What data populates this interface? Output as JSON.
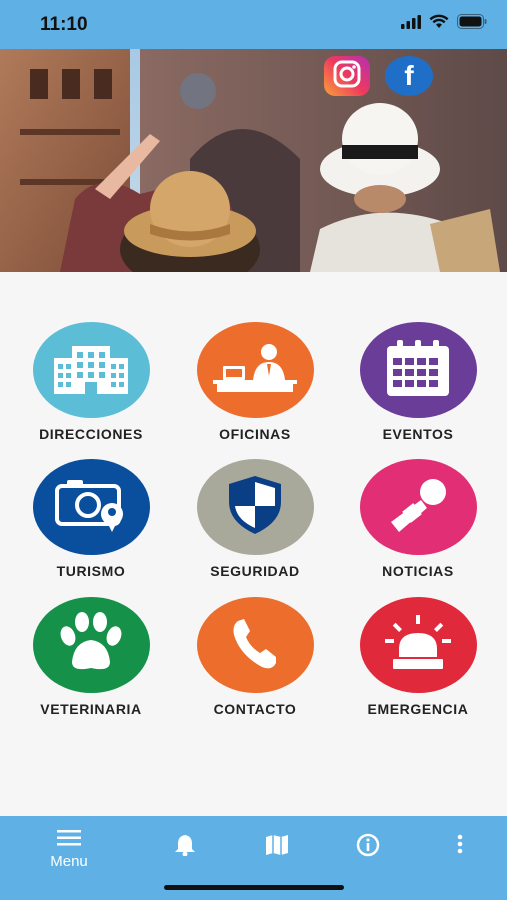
{
  "status_bar": {
    "time": "11:10"
  },
  "hero": {
    "social": [
      {
        "name": "instagram",
        "icon": "instagram-icon"
      },
      {
        "name": "facebook",
        "icon": "facebook-icon",
        "glyph": "f"
      }
    ]
  },
  "menu_grid": [
    {
      "label": "DIRECCIONES",
      "icon": "building-icon",
      "color": "#5bbdd6"
    },
    {
      "label": "OFICINAS",
      "icon": "office-desk-icon",
      "color": "#ec6d2c"
    },
    {
      "label": "EVENTOS",
      "icon": "calendar-icon",
      "color": "#6a3d98"
    },
    {
      "label": "TURISMO",
      "icon": "camera-icon",
      "color": "#0a4f9e"
    },
    {
      "label": "SEGURIDAD",
      "icon": "shield-icon",
      "color": "#a8a99b"
    },
    {
      "label": "NOTICIAS",
      "icon": "microphone-icon",
      "color": "#e12e74"
    },
    {
      "label": "VETERINARIA",
      "icon": "paw-icon",
      "color": "#16914a"
    },
    {
      "label": "CONTACTO",
      "icon": "phone-icon",
      "color": "#ec6d2c"
    },
    {
      "label": "EMERGENCIA",
      "icon": "siren-icon",
      "color": "#e0293b"
    }
  ],
  "bottom_nav": {
    "menu_label": "Menu",
    "items": [
      {
        "icon": "hamburger-menu-icon"
      },
      {
        "icon": "bell-icon"
      },
      {
        "icon": "map-icon"
      },
      {
        "icon": "info-icon"
      },
      {
        "icon": "more-vertical-icon"
      }
    ]
  },
  "colors": {
    "bar": "#5fb0e5",
    "background": "#f6f6f6"
  }
}
